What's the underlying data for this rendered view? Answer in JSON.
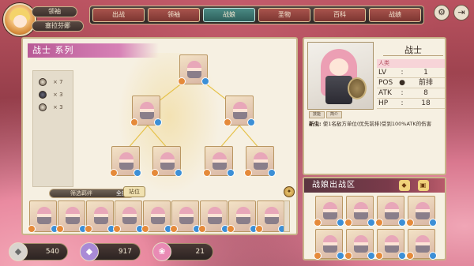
{
  "player": {
    "title": "领袖",
    "name": "塞拉芬娜"
  },
  "nav": {
    "tabs": [
      "出战",
      "领袖",
      "战娘",
      "圣物",
      "百科",
      "战绩"
    ],
    "active": "战娘"
  },
  "settings_icon": "gear-icon",
  "exit_icon": "exit-icon",
  "class_panel": {
    "title": "战士 系列",
    "counts": [
      {
        "icon": "light-orb-icon",
        "value": "× 7"
      },
      {
        "icon": "dark-orb-icon",
        "value": "× 3"
      },
      {
        "icon": "neutral-orb-icon",
        "value": "× 3"
      }
    ],
    "filter_placeholder": "筛选羁绊",
    "filter_all": "全部",
    "stand_button": "站位"
  },
  "detail": {
    "name": "战士",
    "race": "人类",
    "stats": [
      {
        "key": "LV",
        "mid": ":",
        "value": "1"
      },
      {
        "key": "POS",
        "mid": "●",
        "value": "前排"
      },
      {
        "key": "ATK",
        "mid": ":",
        "value": "8"
      },
      {
        "key": "HP",
        "mid": ":",
        "value": "18"
      }
    ],
    "mini_tabs": [
      "技能",
      "简介"
    ],
    "skill_label": "新虫:",
    "skill_text": "使1名敌方单位(优先前排)受到100%ATK的伤害"
  },
  "team": {
    "title": "战娘出战区"
  },
  "currency": [
    {
      "value": "540",
      "icon": "crystal-icon",
      "color": "#d9d4cf"
    },
    {
      "value": "917",
      "icon": "amethyst-icon",
      "color": "#a98ad6"
    },
    {
      "value": "21",
      "icon": "pink-gem-icon",
      "color": "#e98ab4"
    }
  ],
  "colors": {
    "accent": "#c9b48a",
    "banner": "#c66ca6",
    "active_tab": "#3c7a74"
  }
}
